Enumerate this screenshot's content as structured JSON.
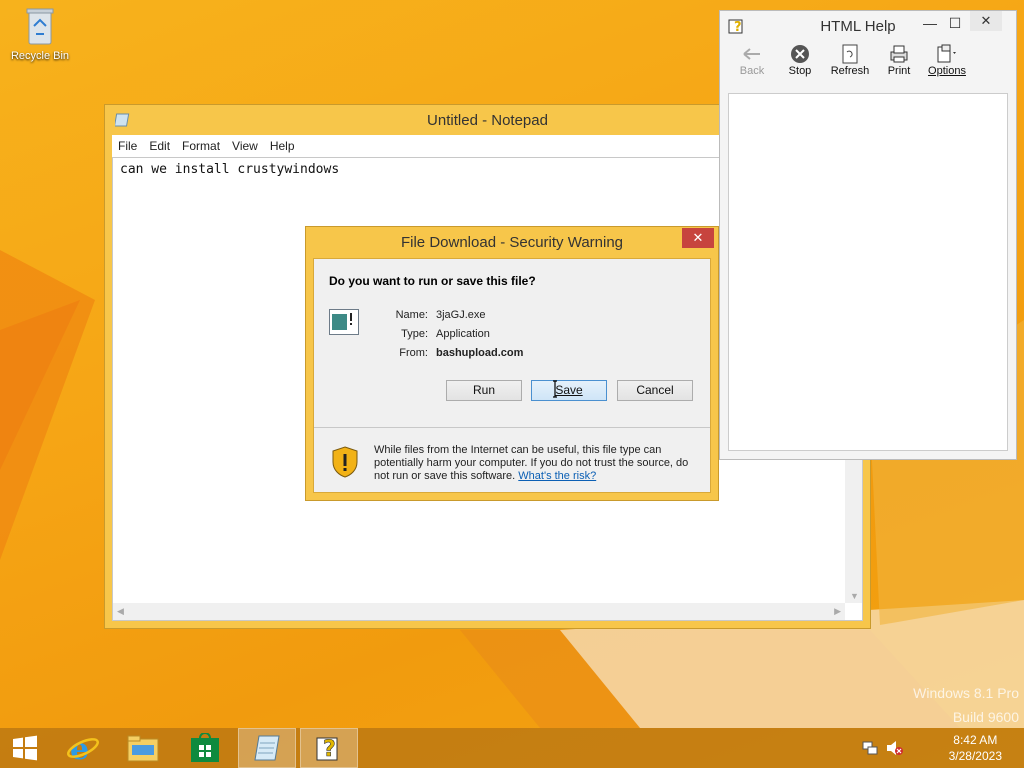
{
  "desktop": {
    "recycle_bin_label": "Recycle Bin",
    "watermark_line1": "Windows 8.1 Pro",
    "watermark_line2": "Build 9600"
  },
  "notepad": {
    "title": "Untitled - Notepad",
    "menu": [
      "File",
      "Edit",
      "Format",
      "View",
      "Help"
    ],
    "content": "can we install crustywindows"
  },
  "html_help": {
    "title": "HTML Help",
    "toolbar": [
      {
        "label": "Back",
        "icon": "back-arrow-icon",
        "enabled": false
      },
      {
        "label": "Stop",
        "icon": "stop-icon",
        "enabled": true
      },
      {
        "label": "Refresh",
        "icon": "refresh-icon",
        "enabled": true
      },
      {
        "label": "Print",
        "icon": "print-icon",
        "enabled": true
      },
      {
        "label": "Options",
        "icon": "options-icon",
        "enabled": true
      }
    ]
  },
  "dialog": {
    "title": "File Download - Security Warning",
    "question": "Do you want to run or save this file?",
    "name_label": "Name:",
    "name_value": "3jaGJ.exe",
    "type_label": "Type:",
    "type_value": "Application",
    "from_label": "From:",
    "from_value": "bashupload.com",
    "run_label": "Run",
    "save_label": "Save",
    "cancel_label": "Cancel",
    "warning_text": "While files from the Internet can be useful, this file type can potentially harm your computer. If you do not trust the source, do not run or save this software.",
    "risk_link": "What's the risk?"
  },
  "taskbar": {
    "time": "8:42 AM",
    "date": "3/28/2023"
  },
  "colors": {
    "desktop_orange": "#f6a515",
    "window_frame": "#f7c64a",
    "close_red": "#c7443e",
    "link_blue": "#0b5fb4"
  }
}
